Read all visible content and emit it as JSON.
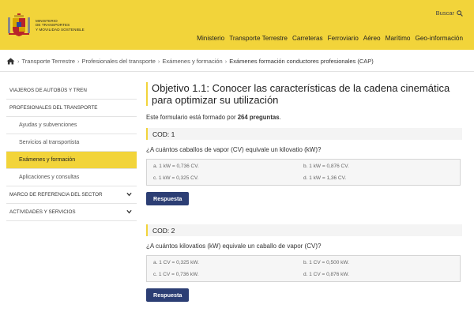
{
  "header": {
    "ministry_lines": [
      "MINISTERIO",
      "DE TRANSPORTES",
      "Y MOVILIDAD SOSTENIBLE"
    ],
    "search_label": "Buscar",
    "nav": [
      "Ministerio",
      "Transporte Terrestre",
      "Carreteras",
      "Ferroviario",
      "Aéreo",
      "Marítimo",
      "Geo-información"
    ]
  },
  "breadcrumb": {
    "items": [
      "Transporte Terrestre",
      "Profesionales del transporte",
      "Exámenes y formación"
    ],
    "current": "Exámenes formación conductores profesionales (CAP)"
  },
  "sidebar": {
    "items": [
      {
        "label": "VIAJEROS DE AUTOBÚS Y TREN"
      },
      {
        "label": "PROFESIONALES DEL TRANSPORTE"
      },
      {
        "label": "Ayudas y subvenciones"
      },
      {
        "label": "Servicios al transportista"
      },
      {
        "label": "Exámenes y formación"
      },
      {
        "label": "Aplicaciones y consultas"
      },
      {
        "label": "MARCO DE REFERENCIA DEL SECTOR"
      },
      {
        "label": "ACTIVIDADES Y SERVICIOS"
      }
    ]
  },
  "main": {
    "title": "Objetivo 1.1: Conocer las características de la cadena cinemática para optimizar su utilización",
    "intro_prefix": "Este formulario está formado por ",
    "intro_count": "264 preguntas",
    "intro_suffix": ".",
    "questions": [
      {
        "cod": "COD: 1",
        "text": "¿A cuántos caballos de vapor (CV) equivale un kilovatio (kW)?",
        "options": [
          "a. 1 kW = 0,736 CV.",
          "b. 1 kW = 0,876 CV.",
          "c. 1 kW = 0,325 CV.",
          "d. 1 kW = 1,36 CV."
        ],
        "button": "Respuesta"
      },
      {
        "cod": "COD: 2",
        "text": "¿A cuántos kilovatios (kW) equivale un caballo de vapor (CV)?",
        "options": [
          "a. 1 CV = 0,325 kW.",
          "b. 1 CV = 0,500 kW.",
          "c. 1 CV = 0,736 kW.",
          "d. 1 CV = 0,876 kW."
        ],
        "button": "Respuesta"
      }
    ]
  },
  "colors": {
    "accent": "#f2d43a",
    "button": "#2c3e74"
  },
  "icons": {
    "home": "home-icon",
    "search": "search-icon",
    "chevron": "chevron-down-icon",
    "logo": "coat-of-arms-icon"
  }
}
